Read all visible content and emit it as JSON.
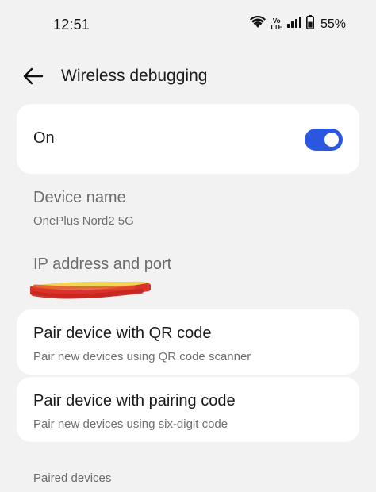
{
  "status_bar": {
    "time": "12:51",
    "volte_top": "Vo",
    "volte_bottom": "LTE",
    "battery_percent": "55%",
    "icons": [
      "wifi-icon",
      "volte-icon",
      "signal-icon",
      "battery-icon"
    ]
  },
  "app_bar": {
    "title": "Wireless debugging",
    "back_icon": "arrow-left-icon"
  },
  "toggle_card": {
    "label": "On",
    "enabled": true,
    "accent_color": "#2b57e0"
  },
  "device_name": {
    "title": "Device name",
    "value": "OnePlus Nord2 5G"
  },
  "ip_address": {
    "title": "IP address and port",
    "value_redacted": true
  },
  "pair_qr": {
    "title": "Pair device with QR code",
    "subtitle": "Pair new devices using QR code scanner"
  },
  "pair_code": {
    "title": "Pair device with pairing code",
    "subtitle": "Pair new devices using six-digit code"
  },
  "paired_devices": {
    "header": "Paired devices"
  }
}
